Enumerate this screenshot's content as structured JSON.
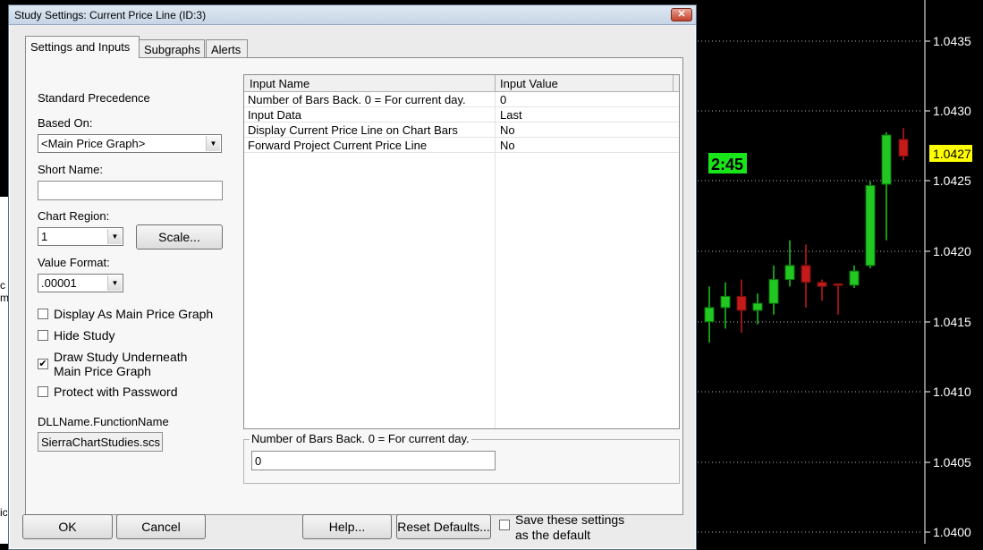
{
  "window": {
    "title": "Study Settings: Current Price Line (ID:3)",
    "close_glyph": "✕"
  },
  "tabs": [
    {
      "label": "Settings and Inputs",
      "active": true
    },
    {
      "label": "Subgraphs",
      "active": false
    },
    {
      "label": "Alerts",
      "active": false
    }
  ],
  "settings": {
    "standard_precedence": "Standard Precedence",
    "based_on_label": "Based On:",
    "based_on_value": "<Main Price Graph>",
    "short_name_label": "Short Name:",
    "short_name_value": "",
    "chart_region_label": "Chart Region:",
    "chart_region_value": "1",
    "scale_button": "Scale...",
    "value_format_label": "Value Format:",
    "value_format_value": ".00001",
    "checkboxes": [
      {
        "label": "Display As Main Price Graph",
        "checked": false
      },
      {
        "label": "Hide Study",
        "checked": false
      },
      {
        "label": "Draw Study Underneath",
        "label2": "Main Price Graph",
        "checked": true
      },
      {
        "label": "Protect with Password",
        "checked": false
      }
    ],
    "dll_label": "DLLName.FunctionName",
    "dll_value": "SierraChartStudies.scs"
  },
  "inputs_grid": {
    "headers": [
      "Input Name",
      "Input Value"
    ],
    "rows": [
      {
        "name": "Number of Bars Back. 0 = For current day.",
        "value": "0"
      },
      {
        "name": "Input Data",
        "value": "Last"
      },
      {
        "name": "Display Current Price Line on Chart Bars",
        "value": "No"
      },
      {
        "name": "Forward Project Current Price Line",
        "value": "No"
      }
    ]
  },
  "selected_input": {
    "label": "Number of Bars Back. 0 = For current day.",
    "value": "0"
  },
  "footer": {
    "ok": "OK",
    "cancel": "Cancel",
    "help": "Help...",
    "reset": "Reset Defaults...",
    "save_default_line1": "Save these settings",
    "save_default_line2": "as the default",
    "save_default_checked": false
  },
  "chart": {
    "price_labels": [
      "1.0435",
      "1.0430",
      "1.0425",
      "1.0420",
      "1.0415",
      "1.0410",
      "1.0405",
      "1.0400"
    ],
    "current_price": "1.0427",
    "timer": "2:45",
    "colors": {
      "up": "#22c722",
      "down": "#c41a1a",
      "timer_bg": "#19e619",
      "current_price_bg": "#ffff00"
    },
    "left_fragments": [
      "c",
      "m",
      "ic"
    ]
  }
}
